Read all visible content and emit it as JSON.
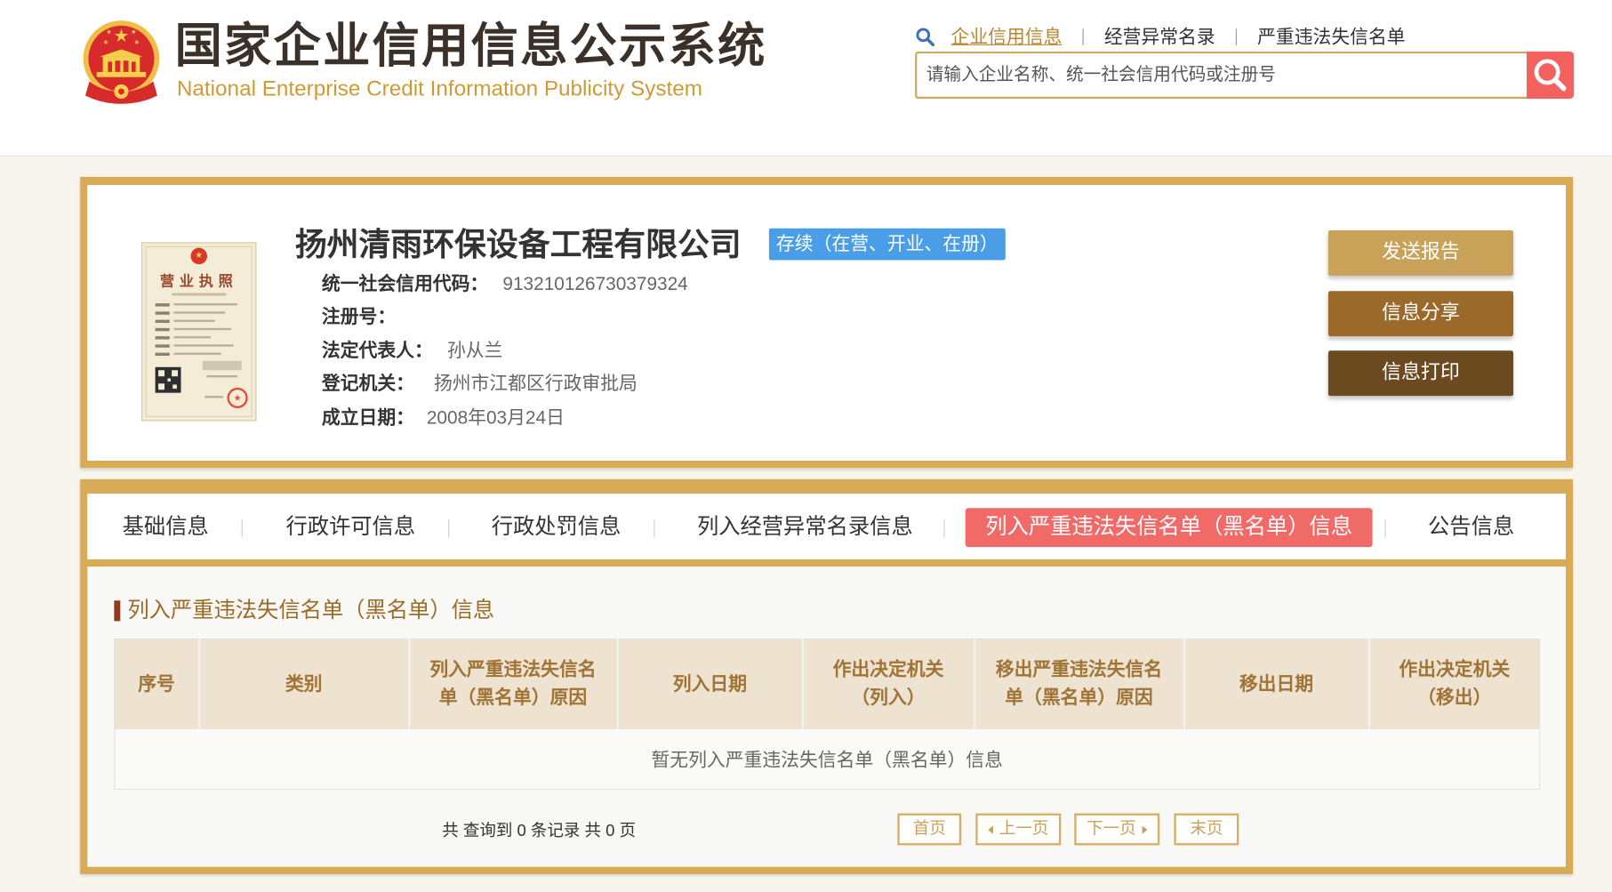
{
  "header": {
    "title_cn": "国家企业信用信息公示系统",
    "title_en": "National Enterprise Credit Information Publicity System",
    "nav": [
      {
        "label": "企业信用信息",
        "active": true
      },
      {
        "label": "经营异常名录",
        "active": false
      },
      {
        "label": "严重违法失信名单",
        "active": false
      }
    ],
    "search_placeholder": "请输入企业名称、统一社会信用代码或注册号",
    "icons": {
      "emblem": "national-emblem-icon",
      "nav": "search-icon",
      "search_button": "search-icon"
    }
  },
  "company": {
    "name": "扬州清雨环保设备工程有限公司",
    "status": "存续（在营、开业、在册）",
    "license_title": "营业执照",
    "fields": [
      {
        "label": "统一社会信用代码：",
        "value": "913210126730379324"
      },
      {
        "label": "注册号："
      },
      {
        "label": "法定代表人：",
        "value": "孙从兰"
      },
      {
        "label": "登记机关：",
        "value": "扬州市江都区行政审批局"
      },
      {
        "label": "成立日期：",
        "value": "2008年03月24日"
      }
    ],
    "actions": {
      "send_report": "发送报告",
      "share": "信息分享",
      "print": "信息打印"
    }
  },
  "tabs": [
    {
      "label": "基础信息",
      "active": false
    },
    {
      "label": "行政许可信息",
      "active": false
    },
    {
      "label": "行政处罚信息",
      "active": false
    },
    {
      "label": "列入经营异常名录信息",
      "active": false
    },
    {
      "label": "列入严重违法失信名单（黑名单）信息",
      "active": true
    },
    {
      "label": "公告信息",
      "active": false
    }
  ],
  "blacklist": {
    "title": "列入严重违法失信名单（黑名单）信息",
    "columns": [
      [
        "序号"
      ],
      [
        "类别"
      ],
      [
        "列入严重违法失信名",
        "单（黑名单）原因"
      ],
      [
        "列入日期"
      ],
      [
        "作出决定机关",
        "（列入）"
      ],
      [
        "移出严重违法失信名",
        "单（黑名单）原因"
      ],
      [
        "移出日期"
      ],
      [
        "作出决定机关",
        "（移出）"
      ]
    ],
    "empty_text": "暂无列入严重违法失信名单（黑名单）信息"
  },
  "pagination": {
    "summary": "共 查询到 0 条记录 共 0 页",
    "first": "首页",
    "prev": "上一页",
    "next": "下一页",
    "last": "末页"
  },
  "colors": {
    "gold": "#d8ac57",
    "active_tab": "#f06a67",
    "status_badge": "#4a9ee8",
    "search_button": "#f3625f",
    "send_report": "#c9a25a",
    "share": "#9b6a2b",
    "print": "#6b4a1f"
  }
}
